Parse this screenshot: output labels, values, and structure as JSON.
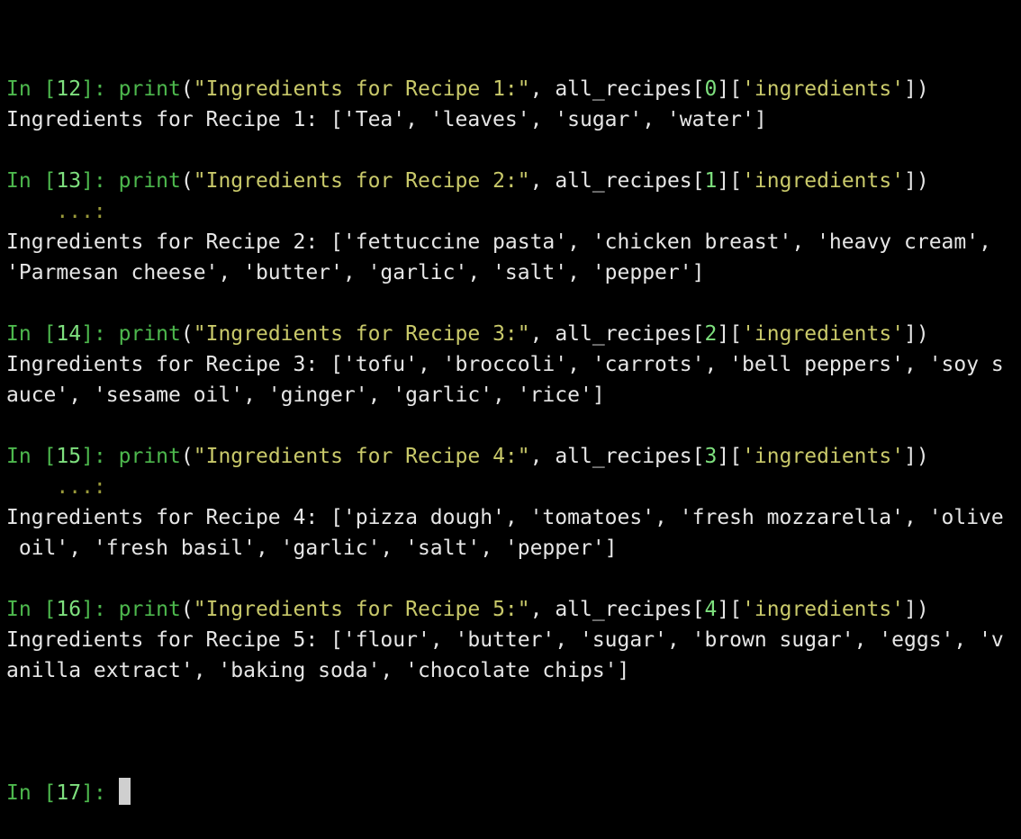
{
  "cells": [
    {
      "prompt_in": "In [",
      "number": "12",
      "prompt_close": "]: ",
      "fn": "print",
      "open_paren": "(",
      "string": "\"Ingredients for Recipe 1:\"",
      "args_mid": ", all_recipes[",
      "index": "0",
      "args_mid2": "][",
      "key": "'ingredients'",
      "args_end": "])",
      "continuation": "",
      "output": [
        "Ingredients for Recipe 1: ['Tea', 'leaves', 'sugar', 'water']"
      ]
    },
    {
      "prompt_in": "In [",
      "number": "13",
      "prompt_close": "]: ",
      "fn": "print",
      "open_paren": "(",
      "string": "\"Ingredients for Recipe 2:\"",
      "args_mid": ", all_recipes[",
      "index": "1",
      "args_mid2": "][",
      "key": "'ingredients'",
      "args_end": "])",
      "continuation": "    ...:",
      "output": [
        "Ingredients for Recipe 2: ['fettuccine pasta', 'chicken breast', 'heavy cream',",
        "'Parmesan cheese', 'butter', 'garlic', 'salt', 'pepper']"
      ]
    },
    {
      "prompt_in": "In [",
      "number": "14",
      "prompt_close": "]: ",
      "fn": "print",
      "open_paren": "(",
      "string": "\"Ingredients for Recipe 3:\"",
      "args_mid": ", all_recipes[",
      "index": "2",
      "args_mid2": "][",
      "key": "'ingredients'",
      "args_end": "])",
      "continuation": "",
      "output": [
        "Ingredients for Recipe 3: ['tofu', 'broccoli', 'carrots', 'bell peppers', 'soy s",
        "auce', 'sesame oil', 'ginger', 'garlic', 'rice']"
      ]
    },
    {
      "prompt_in": "In [",
      "number": "15",
      "prompt_close": "]: ",
      "fn": "print",
      "open_paren": "(",
      "string": "\"Ingredients for Recipe 4:\"",
      "args_mid": ", all_recipes[",
      "index": "3",
      "args_mid2": "][",
      "key": "'ingredients'",
      "args_end": "])",
      "continuation": "    ...:",
      "output": [
        "Ingredients for Recipe 4: ['pizza dough', 'tomatoes', 'fresh mozzarella', 'olive",
        " oil', 'fresh basil', 'garlic', 'salt', 'pepper']"
      ]
    },
    {
      "prompt_in": "In [",
      "number": "16",
      "prompt_close": "]: ",
      "fn": "print",
      "open_paren": "(",
      "string": "\"Ingredients for Recipe 5:\"",
      "args_mid": ", all_recipes[",
      "index": "4",
      "args_mid2": "][",
      "key": "'ingredients'",
      "args_end": "])",
      "continuation": "",
      "output": [
        "Ingredients for Recipe 5: ['flour', 'butter', 'sugar', 'brown sugar', 'eggs', 'v",
        "anilla extract', 'baking soda', 'chocolate chips']"
      ]
    }
  ],
  "active_prompt": {
    "prompt_in": "In [",
    "number": "17",
    "prompt_close": "]: "
  },
  "colors": {
    "background": "#000000",
    "text": "#e6e6e6",
    "prompt": "#4db84d",
    "string": "#c9c96a",
    "cursor": "#cfcfcf"
  }
}
